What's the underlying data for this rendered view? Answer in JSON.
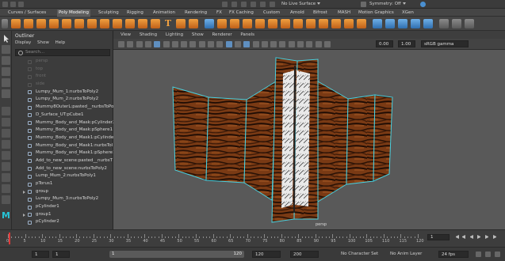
{
  "topbar": {
    "workspace": "",
    "live_surface": "No Live Surface",
    "symmetry": "Symmetry: Off"
  },
  "shelf_tabs": [
    "Curves / Surfaces",
    "Poly Modeling",
    "Sculpting",
    "Rigging",
    "Animation",
    "Rendering",
    "FX",
    "FX Caching",
    "Custom",
    "Arnold",
    "Bifrost",
    "MASH",
    "Motion Graphics",
    "XGen"
  ],
  "active_shelf_tab": "Poly Modeling",
  "outliner": {
    "title": "Outliner",
    "menu": [
      "Display",
      "Show",
      "Help"
    ],
    "search_placeholder": "Search...",
    "items": [
      {
        "label": "persp",
        "kind": "camera"
      },
      {
        "label": "top",
        "kind": "camera"
      },
      {
        "label": "front",
        "kind": "camera"
      },
      {
        "label": "side",
        "kind": "camera"
      },
      {
        "label": "Lumpy_Mum_1:nurbsToPoly2",
        "kind": "mesh"
      },
      {
        "label": "Lumpy_Mum_2:nurbsToPoly2",
        "kind": "mesh"
      },
      {
        "label": "Mummy8OuterL:pasted__nurbsToPo",
        "kind": "mesh"
      },
      {
        "label": "D_Surface_UT:pCube1",
        "kind": "mesh"
      },
      {
        "label": "Mummy_Body_and_Mask:pCylinder2",
        "kind": "mesh"
      },
      {
        "label": "Mummy_Body_and_Mask:pSphere1",
        "kind": "mesh"
      },
      {
        "label": "Mummy_Body_and_Mask1:pCylinde",
        "kind": "mesh"
      },
      {
        "label": "Mummy_Body_and_Mask1:nurbsToI",
        "kind": "mesh"
      },
      {
        "label": "Mummy_Body_and_Mask1:pSphere1",
        "kind": "mesh"
      },
      {
        "label": "Add_to_new_scene:pasted__nurbsT",
        "kind": "mesh"
      },
      {
        "label": "Add_to_new_scene:nurbsToPoly2",
        "kind": "mesh"
      },
      {
        "label": "Lump_Mum_2:nurbsToPoly1",
        "kind": "mesh"
      },
      {
        "label": "pTorus1",
        "kind": "mesh"
      },
      {
        "label": "group",
        "kind": "group"
      },
      {
        "label": "Lumpy_Mum_3:nurbsToPoly2",
        "kind": "mesh"
      },
      {
        "label": "pCylinder1",
        "kind": "mesh"
      },
      {
        "label": "group1",
        "kind": "group"
      },
      {
        "label": "pCylinder2",
        "kind": "mesh"
      }
    ]
  },
  "viewport": {
    "menu": [
      "View",
      "Shading",
      "Lighting",
      "Show",
      "Renderer",
      "Panels"
    ],
    "exposure": "0.00",
    "gamma": "1.00",
    "color_space": "sRGB gamma",
    "camera_label": "persp"
  },
  "timeline": {
    "ticks": [
      "0",
      "5",
      "10",
      "15",
      "20",
      "25",
      "30",
      "35",
      "40",
      "45",
      "50",
      "55",
      "60",
      "65",
      "70",
      "75",
      "80",
      "85",
      "90",
      "95",
      "100",
      "105",
      "110",
      "115",
      "120"
    ],
    "current_frame": "1"
  },
  "range": {
    "start": "1",
    "inner_start": "1",
    "range_left": "1",
    "range_right": "120",
    "inner_end": "120",
    "end": "200",
    "character_set": "No Character Set",
    "anim_layer": "No Anim Layer",
    "fps": "24 fps"
  },
  "colors": {
    "accent": "#5f8fc0",
    "shelf_orange": "#e8923a",
    "wireframe": "#48d0e0",
    "wood": "#7a3a14"
  }
}
